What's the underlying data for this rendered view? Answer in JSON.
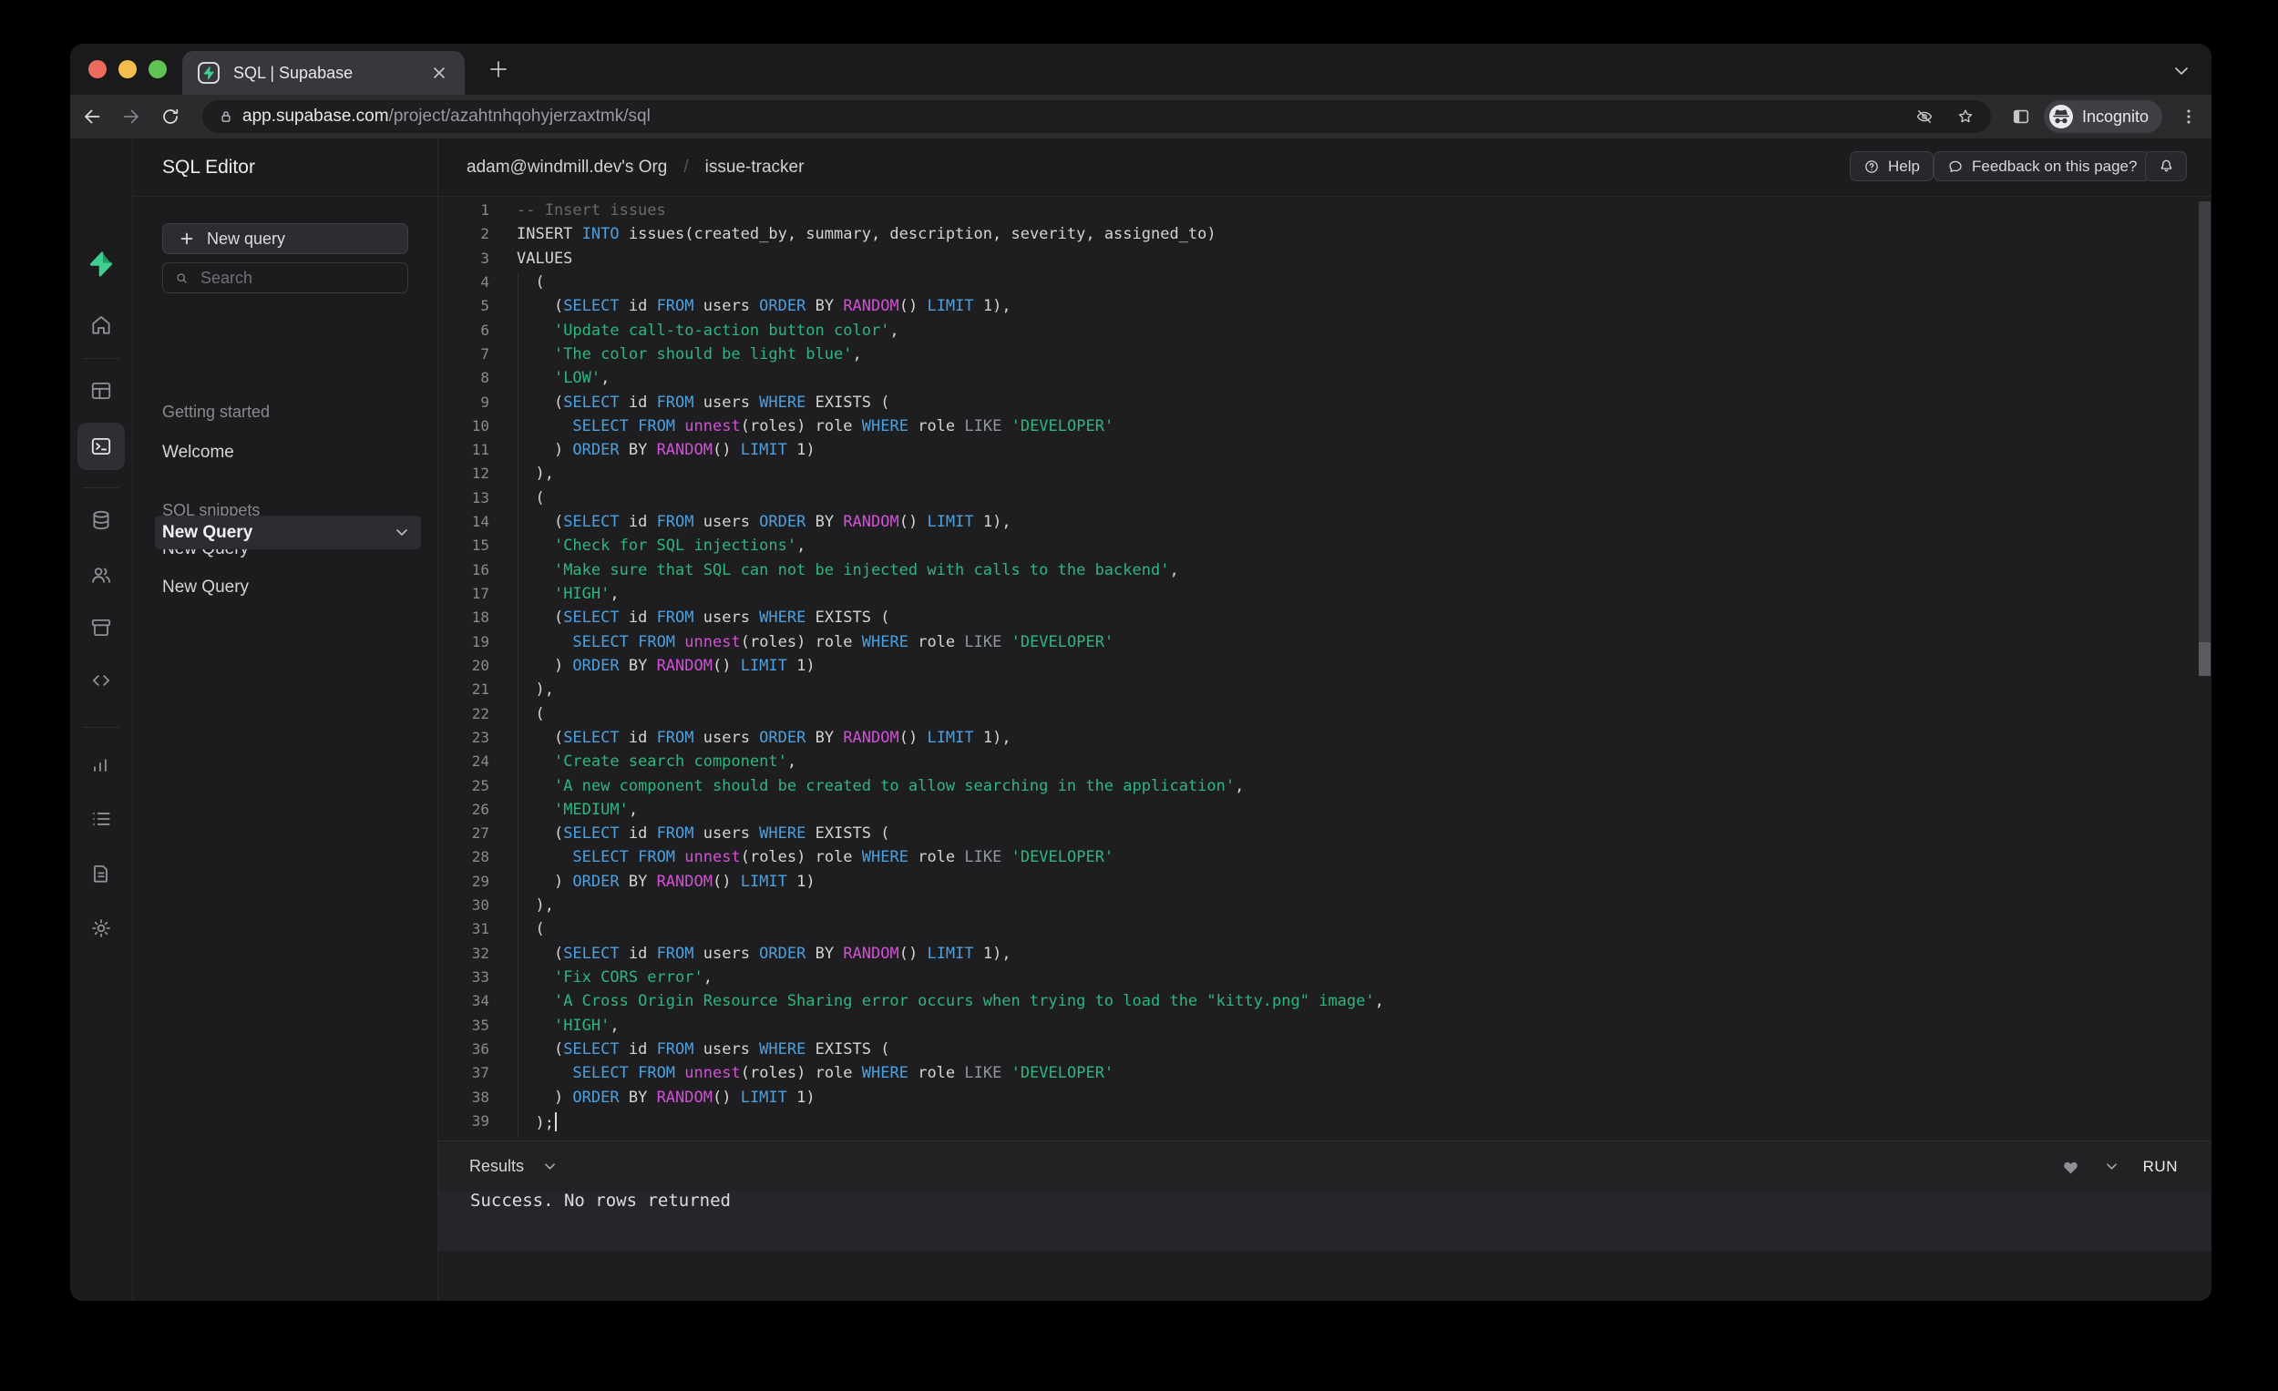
{
  "browser": {
    "tab_title": "SQL | Supabase",
    "url": {
      "host": "app.supabase.com",
      "path": "/project/azahtnhqohyjerzaxtmk/sql"
    },
    "incognito_label": "Incognito",
    "colors": {
      "traffic_red": "#ED6A5E",
      "traffic_yellow": "#F4BE4F",
      "traffic_green": "#61C354"
    },
    "icons": [
      "close-window",
      "minimize-window",
      "zoom-window",
      "supabase-favicon",
      "tab-close",
      "new-tab-plus",
      "tab-list-chevron",
      "back-arrow",
      "forward-arrow",
      "reload",
      "lock",
      "eye-off",
      "star",
      "side-panel",
      "incognito-spy",
      "kebab-menu"
    ]
  },
  "app": {
    "brand_color": "#3ECF8E",
    "rail": {
      "icons": [
        "supabase-logo",
        "home",
        "table-editor",
        "sql-editor",
        "database",
        "auth-users",
        "storage",
        "api-code",
        "reports",
        "logs",
        "docs",
        "settings",
        "account"
      ],
      "active": "sql-editor"
    },
    "panel": {
      "title": "SQL Editor",
      "new_query_button": "New query",
      "search_placeholder": "Search",
      "section1_label": "Getting started",
      "welcome_item": "Welcome",
      "section2_label": "SQL snippets",
      "query_item_1": "New Query",
      "query_item_2": "New Query",
      "query_item_3": "New Query"
    },
    "header": {
      "org": "adam@windmill.dev's Org",
      "separator": "/",
      "project": "issue-tracker",
      "help_button": "Help",
      "feedback_button": "Feedback on this page?"
    },
    "results": {
      "bar_label": "Results",
      "run_button": "RUN",
      "message": "Success. No rows returned"
    },
    "editor": {
      "cursor_line": 39,
      "token_colors": {
        "k": "#4BA0E0",
        "f": "#D44FD8",
        "s": "#2EB67D",
        "c": "#6A6A6A",
        "o": "#8F969C",
        "d": "#D4D4D4"
      },
      "lines": [
        [
          [
            "c",
            "-- Insert issues"
          ]
        ],
        [
          [
            "d",
            "INSERT "
          ],
          [
            "k",
            "INTO"
          ],
          [
            "d",
            " issues(created_by, summary, description, severity, assigned_to)"
          ]
        ],
        [
          [
            "d",
            "VALUES"
          ]
        ],
        [
          [
            "d",
            "  ("
          ]
        ],
        [
          [
            "d",
            "    ("
          ],
          [
            "k",
            "SELECT"
          ],
          [
            "d",
            " id "
          ],
          [
            "k",
            "FROM"
          ],
          [
            "d",
            " users "
          ],
          [
            "k",
            "ORDER"
          ],
          [
            "d",
            " BY "
          ],
          [
            "f",
            "RANDOM"
          ],
          [
            "d",
            "() "
          ],
          [
            "k",
            "LIMIT"
          ],
          [
            "d",
            " 1),"
          ]
        ],
        [
          [
            "d",
            "    "
          ],
          [
            "s",
            "'Update call-to-action button color'"
          ],
          [
            "d",
            ","
          ]
        ],
        [
          [
            "d",
            "    "
          ],
          [
            "s",
            "'The color should be light blue'"
          ],
          [
            "d",
            ","
          ]
        ],
        [
          [
            "d",
            "    "
          ],
          [
            "s",
            "'LOW'"
          ],
          [
            "d",
            ","
          ]
        ],
        [
          [
            "d",
            "    ("
          ],
          [
            "k",
            "SELECT"
          ],
          [
            "d",
            " id "
          ],
          [
            "k",
            "FROM"
          ],
          [
            "d",
            " users "
          ],
          [
            "k",
            "WHERE"
          ],
          [
            "d",
            " EXISTS ("
          ]
        ],
        [
          [
            "d",
            "      "
          ],
          [
            "k",
            "SELECT"
          ],
          [
            "d",
            " "
          ],
          [
            "k",
            "FROM"
          ],
          [
            "d",
            " "
          ],
          [
            "f",
            "unnest"
          ],
          [
            "d",
            "(roles) role "
          ],
          [
            "k",
            "WHERE"
          ],
          [
            "d",
            " role "
          ],
          [
            "o",
            "LIKE"
          ],
          [
            "d",
            " "
          ],
          [
            "s",
            "'DEVELOPER'"
          ]
        ],
        [
          [
            "d",
            "    ) "
          ],
          [
            "k",
            "ORDER"
          ],
          [
            "d",
            " BY "
          ],
          [
            "f",
            "RANDOM"
          ],
          [
            "d",
            "() "
          ],
          [
            "k",
            "LIMIT"
          ],
          [
            "d",
            " 1)"
          ]
        ],
        [
          [
            "d",
            "  ),"
          ]
        ],
        [
          [
            "d",
            "  ("
          ]
        ],
        [
          [
            "d",
            "    ("
          ],
          [
            "k",
            "SELECT"
          ],
          [
            "d",
            " id "
          ],
          [
            "k",
            "FROM"
          ],
          [
            "d",
            " users "
          ],
          [
            "k",
            "ORDER"
          ],
          [
            "d",
            " BY "
          ],
          [
            "f",
            "RANDOM"
          ],
          [
            "d",
            "() "
          ],
          [
            "k",
            "LIMIT"
          ],
          [
            "d",
            " 1),"
          ]
        ],
        [
          [
            "d",
            "    "
          ],
          [
            "s",
            "'Check for SQL injections'"
          ],
          [
            "d",
            ","
          ]
        ],
        [
          [
            "d",
            "    "
          ],
          [
            "s",
            "'Make sure that SQL can not be injected with calls to the backend'"
          ],
          [
            "d",
            ","
          ]
        ],
        [
          [
            "d",
            "    "
          ],
          [
            "s",
            "'HIGH'"
          ],
          [
            "d",
            ","
          ]
        ],
        [
          [
            "d",
            "    ("
          ],
          [
            "k",
            "SELECT"
          ],
          [
            "d",
            " id "
          ],
          [
            "k",
            "FROM"
          ],
          [
            "d",
            " users "
          ],
          [
            "k",
            "WHERE"
          ],
          [
            "d",
            " EXISTS ("
          ]
        ],
        [
          [
            "d",
            "      "
          ],
          [
            "k",
            "SELECT"
          ],
          [
            "d",
            " "
          ],
          [
            "k",
            "FROM"
          ],
          [
            "d",
            " "
          ],
          [
            "f",
            "unnest"
          ],
          [
            "d",
            "(roles) role "
          ],
          [
            "k",
            "WHERE"
          ],
          [
            "d",
            " role "
          ],
          [
            "o",
            "LIKE"
          ],
          [
            "d",
            " "
          ],
          [
            "s",
            "'DEVELOPER'"
          ]
        ],
        [
          [
            "d",
            "    ) "
          ],
          [
            "k",
            "ORDER"
          ],
          [
            "d",
            " BY "
          ],
          [
            "f",
            "RANDOM"
          ],
          [
            "d",
            "() "
          ],
          [
            "k",
            "LIMIT"
          ],
          [
            "d",
            " 1)"
          ]
        ],
        [
          [
            "d",
            "  ),"
          ]
        ],
        [
          [
            "d",
            "  ("
          ]
        ],
        [
          [
            "d",
            "    ("
          ],
          [
            "k",
            "SELECT"
          ],
          [
            "d",
            " id "
          ],
          [
            "k",
            "FROM"
          ],
          [
            "d",
            " users "
          ],
          [
            "k",
            "ORDER"
          ],
          [
            "d",
            " BY "
          ],
          [
            "f",
            "RANDOM"
          ],
          [
            "d",
            "() "
          ],
          [
            "k",
            "LIMIT"
          ],
          [
            "d",
            " 1),"
          ]
        ],
        [
          [
            "d",
            "    "
          ],
          [
            "s",
            "'Create search component'"
          ],
          [
            "d",
            ","
          ]
        ],
        [
          [
            "d",
            "    "
          ],
          [
            "s",
            "'A new component should be created to allow searching in the application'"
          ],
          [
            "d",
            ","
          ]
        ],
        [
          [
            "d",
            "    "
          ],
          [
            "s",
            "'MEDIUM'"
          ],
          [
            "d",
            ","
          ]
        ],
        [
          [
            "d",
            "    ("
          ],
          [
            "k",
            "SELECT"
          ],
          [
            "d",
            " id "
          ],
          [
            "k",
            "FROM"
          ],
          [
            "d",
            " users "
          ],
          [
            "k",
            "WHERE"
          ],
          [
            "d",
            " EXISTS ("
          ]
        ],
        [
          [
            "d",
            "      "
          ],
          [
            "k",
            "SELECT"
          ],
          [
            "d",
            " "
          ],
          [
            "k",
            "FROM"
          ],
          [
            "d",
            " "
          ],
          [
            "f",
            "unnest"
          ],
          [
            "d",
            "(roles) role "
          ],
          [
            "k",
            "WHERE"
          ],
          [
            "d",
            " role "
          ],
          [
            "o",
            "LIKE"
          ],
          [
            "d",
            " "
          ],
          [
            "s",
            "'DEVELOPER'"
          ]
        ],
        [
          [
            "d",
            "    ) "
          ],
          [
            "k",
            "ORDER"
          ],
          [
            "d",
            " BY "
          ],
          [
            "f",
            "RANDOM"
          ],
          [
            "d",
            "() "
          ],
          [
            "k",
            "LIMIT"
          ],
          [
            "d",
            " 1)"
          ]
        ],
        [
          [
            "d",
            "  ),"
          ]
        ],
        [
          [
            "d",
            "  ("
          ]
        ],
        [
          [
            "d",
            "    ("
          ],
          [
            "k",
            "SELECT"
          ],
          [
            "d",
            " id "
          ],
          [
            "k",
            "FROM"
          ],
          [
            "d",
            " users "
          ],
          [
            "k",
            "ORDER"
          ],
          [
            "d",
            " BY "
          ],
          [
            "f",
            "RANDOM"
          ],
          [
            "d",
            "() "
          ],
          [
            "k",
            "LIMIT"
          ],
          [
            "d",
            " 1),"
          ]
        ],
        [
          [
            "d",
            "    "
          ],
          [
            "s",
            "'Fix CORS error'"
          ],
          [
            "d",
            ","
          ]
        ],
        [
          [
            "d",
            "    "
          ],
          [
            "s",
            "'A Cross Origin Resource Sharing error occurs when trying to load the \"kitty.png\" image'"
          ],
          [
            "d",
            ","
          ]
        ],
        [
          [
            "d",
            "    "
          ],
          [
            "s",
            "'HIGH'"
          ],
          [
            "d",
            ","
          ]
        ],
        [
          [
            "d",
            "    ("
          ],
          [
            "k",
            "SELECT"
          ],
          [
            "d",
            " id "
          ],
          [
            "k",
            "FROM"
          ],
          [
            "d",
            " users "
          ],
          [
            "k",
            "WHERE"
          ],
          [
            "d",
            " EXISTS ("
          ]
        ],
        [
          [
            "d",
            "      "
          ],
          [
            "k",
            "SELECT"
          ],
          [
            "d",
            " "
          ],
          [
            "k",
            "FROM"
          ],
          [
            "d",
            " "
          ],
          [
            "f",
            "unnest"
          ],
          [
            "d",
            "(roles) role "
          ],
          [
            "k",
            "WHERE"
          ],
          [
            "d",
            " role "
          ],
          [
            "o",
            "LIKE"
          ],
          [
            "d",
            " "
          ],
          [
            "s",
            "'DEVELOPER'"
          ]
        ],
        [
          [
            "d",
            "    ) "
          ],
          [
            "k",
            "ORDER"
          ],
          [
            "d",
            " BY "
          ],
          [
            "f",
            "RANDOM"
          ],
          [
            "d",
            "() "
          ],
          [
            "k",
            "LIMIT"
          ],
          [
            "d",
            " 1)"
          ]
        ],
        [
          [
            "d",
            "  );"
          ]
        ]
      ]
    }
  }
}
